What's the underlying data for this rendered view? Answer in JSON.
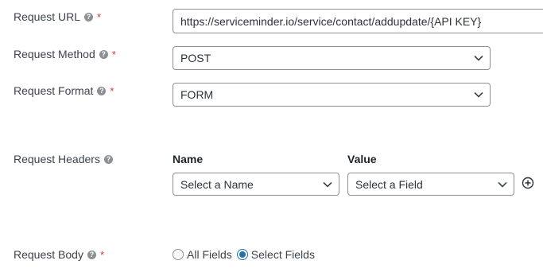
{
  "request_url": {
    "label": "Request URL",
    "required_marker": "*",
    "value": "https://serviceminder.io/service/contact/addupdate/{API KEY}"
  },
  "request_method": {
    "label": "Request Method",
    "required_marker": "*",
    "selected": "POST"
  },
  "request_format": {
    "label": "Request Format",
    "required_marker": "*",
    "selected": "FORM"
  },
  "request_headers": {
    "label": "Request Headers",
    "name_column": "Name",
    "value_column": "Value",
    "name_select": "Select a Name",
    "value_select": "Select a Field"
  },
  "request_body": {
    "label": "Request Body",
    "required_marker": "*",
    "options": [
      "All Fields",
      "Select Fields"
    ],
    "selected_option": "Select Fields"
  },
  "help_glyph": "?",
  "icons": {
    "help": "question-circle-icon",
    "chevron": "chevron-down-icon",
    "add": "plus-circle-icon"
  },
  "colors": {
    "required": "#d63638",
    "radio_checked": "#2271b1",
    "border": "#8c8f94"
  }
}
